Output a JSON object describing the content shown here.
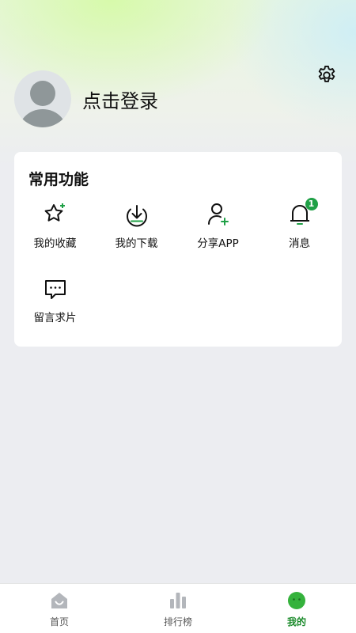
{
  "profile": {
    "login_text": "点击登录"
  },
  "section": {
    "title": "常用功能",
    "items": [
      {
        "label": "我的收藏",
        "icon": "star-sparkle-icon"
      },
      {
        "label": "我的下载",
        "icon": "download-icon"
      },
      {
        "label": "分享APP",
        "icon": "user-add-icon"
      },
      {
        "label": "消息",
        "icon": "bell-icon",
        "badge": "1"
      },
      {
        "label": "留言求片",
        "icon": "message-icon"
      }
    ]
  },
  "tabbar": {
    "tabs": [
      {
        "label": "首页",
        "icon": "home-icon",
        "active": false
      },
      {
        "label": "排行榜",
        "icon": "ranking-icon",
        "active": false
      },
      {
        "label": "我的",
        "icon": "mine-icon",
        "active": true
      }
    ]
  },
  "colors": {
    "accent": "#1fa046",
    "background": "#ecedf1"
  }
}
